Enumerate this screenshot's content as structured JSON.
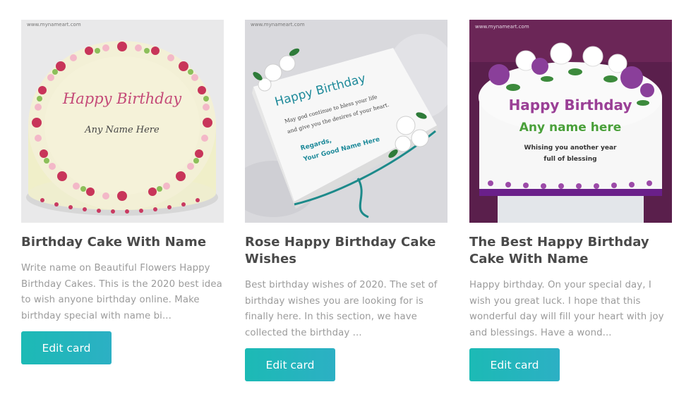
{
  "cards": [
    {
      "title": "Birthday Cake With Name",
      "description": "Write name on Beautiful Flowers Happy Birthday Cakes. This is the 2020 best idea to wish anyone birthday online. Make birthday special with name bi...",
      "button_label": "Edit card",
      "image": {
        "watermark": "www.mynameart.com",
        "heading": "Happy Birthday",
        "name_line": "Any Name Here"
      }
    },
    {
      "title": "Rose Happy Birthday Cake Wishes",
      "description": "Best birthday wishes of 2020. The set of birthday wishes you are looking for is finally here. In this section, we have collected the birthday ...",
      "button_label": "Edit card",
      "image": {
        "watermark": "www.mynameart.com",
        "heading": "Happy Birthday",
        "message_1": "May god continue to bless your life",
        "message_2": "and give you the desires of your heart.",
        "regards": "Regards,",
        "signature": "Your Good Name Here"
      }
    },
    {
      "title": "The Best Happy Birthday Cake With Name",
      "description": "Happy birthday. On your special day, I wish you great luck. I hope that this wonderful day will fill your heart with joy and blessings. Have a wond...",
      "button_label": "Edit card",
      "image": {
        "watermark": "www.mynameart.com",
        "heading": "Happy Birthday",
        "name_line": "Any name here",
        "wish_1": "Whising you another year",
        "wish_2": "full of blessing"
      }
    }
  ],
  "colors": {
    "button_start": "#1cbab5",
    "button_end": "#2cb0c4",
    "title": "#4a4a4a",
    "description": "#9b9b9b"
  }
}
